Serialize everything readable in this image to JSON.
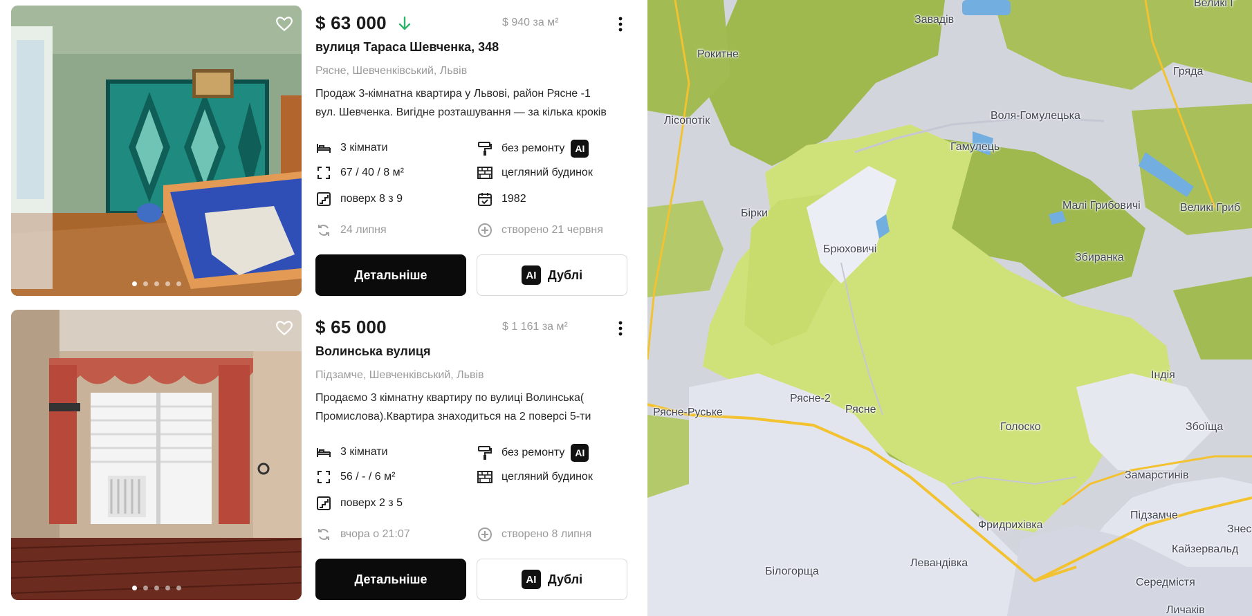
{
  "listings": [
    {
      "price": "$ 63 000",
      "price_per_m2": "$ 940 за м²",
      "title": "вулиця Тараса Шевченка, 348",
      "location": "Рясне, Шевченківський, Львів",
      "desc_line1": "Продаж 3-кімнатна квартира у Львові, район Рясне -1",
      "desc_line2": "вул. Шевченка. Вигідне розташування — за кілька кроків",
      "rooms": "3 кімнати",
      "condition": "без ремонту",
      "area": "67 / 40 / 8 м²",
      "building": "цегляний будинок",
      "floor": "поверх 8 з 9",
      "year": "1982",
      "updated": "24 липня",
      "created": "створено 21 червня",
      "ai_label": "AI",
      "detail_label": "Детальніше",
      "dupes_label": "Дублі"
    },
    {
      "price": "$ 65 000",
      "price_per_m2": "$ 1 161 за м²",
      "title": "Волинська вулиця",
      "location": "Підзамче, Шевченківський, Львів",
      "desc_line1": "Продаємо 3 кімнатну квартиру по вулиці Волинська(",
      "desc_line2": "Промислова).Квартира знаходиться на 2 поверсі 5-ти",
      "rooms": "3 кімнати",
      "condition": "без ремонту",
      "area": "56 / - / 6 м²",
      "building": "цегляний будинок",
      "floor": "поверх 2 з 5",
      "updated": "вчора о 21:07",
      "created": "створено 8 липня",
      "ai_label": "AI",
      "detail_label": "Детальніше",
      "dupes_label": "Дублі"
    }
  ],
  "map": {
    "labels": [
      "Завадів",
      "Великі Г",
      "Рокитне",
      "Гряда",
      "Лісопотік",
      "Воля-Гомулецька",
      "Гамулець",
      "Бірки",
      "Малі Грибовичі",
      "Великі Гриб",
      "Брюховичі",
      "Збиранка",
      "Індія",
      "Рясне-2",
      "Рясне",
      "Рясне-Руське",
      "Голоско",
      "Збоїща",
      "Замарстинів",
      "Підзамче",
      "Фридрихівка",
      "Знес",
      "Кайзервальд",
      "Білогорща",
      "Левандівка",
      "Середмістя",
      "Личаків"
    ]
  },
  "colors": {
    "accent_black": "#0b0b0b",
    "price_down": "#2fb36a",
    "map_green": "#cfe27a",
    "map_dark_green": "#9fb94e",
    "map_road": "#f2c230"
  }
}
